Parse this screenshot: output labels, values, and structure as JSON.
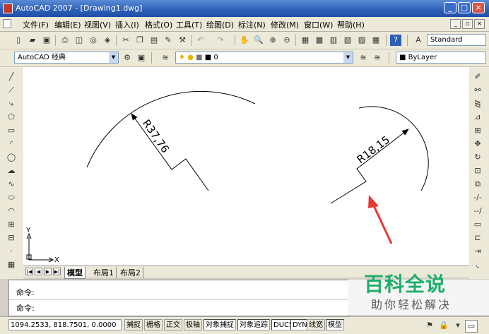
{
  "window": {
    "title": "AutoCAD 2007 - [Drawing1.dwg]"
  },
  "menu": [
    "文件(F)",
    "编辑(E)",
    "视图(V)",
    "插入(I)",
    "格式(O)",
    "工具(T)",
    "绘图(D)",
    "标注(N)",
    "修改(M)",
    "窗口(W)",
    "帮助(H)"
  ],
  "toolbar": {
    "text_style": "Standard",
    "workspace": "AutoCAD 经典",
    "layer": "0",
    "color": "ByLayer"
  },
  "drawing": {
    "dim_large": "R37,76",
    "dim_small": "R18,15",
    "ucs_x": "X",
    "ucs_y": "Y"
  },
  "tabs": {
    "model": "模型",
    "layout1": "布局1",
    "layout2": "布局2"
  },
  "command": {
    "line1": "命令:",
    "line2": "命令:"
  },
  "status": {
    "coords": "1094.2533,  818.7501,  0.0000",
    "buttons": [
      "捕捉",
      "栅格",
      "正交",
      "极轴",
      "对象捕捉",
      "对象追踪",
      "DUCS",
      "DYN",
      "线宽",
      "模型"
    ]
  },
  "watermark": {
    "title": "百科全说",
    "subtitle": "助你轻松解决"
  },
  "colors": {
    "annotation_arrow": "#e53935",
    "watermark_green": "#1fae6a",
    "titlebar": "#2d5fb8"
  }
}
